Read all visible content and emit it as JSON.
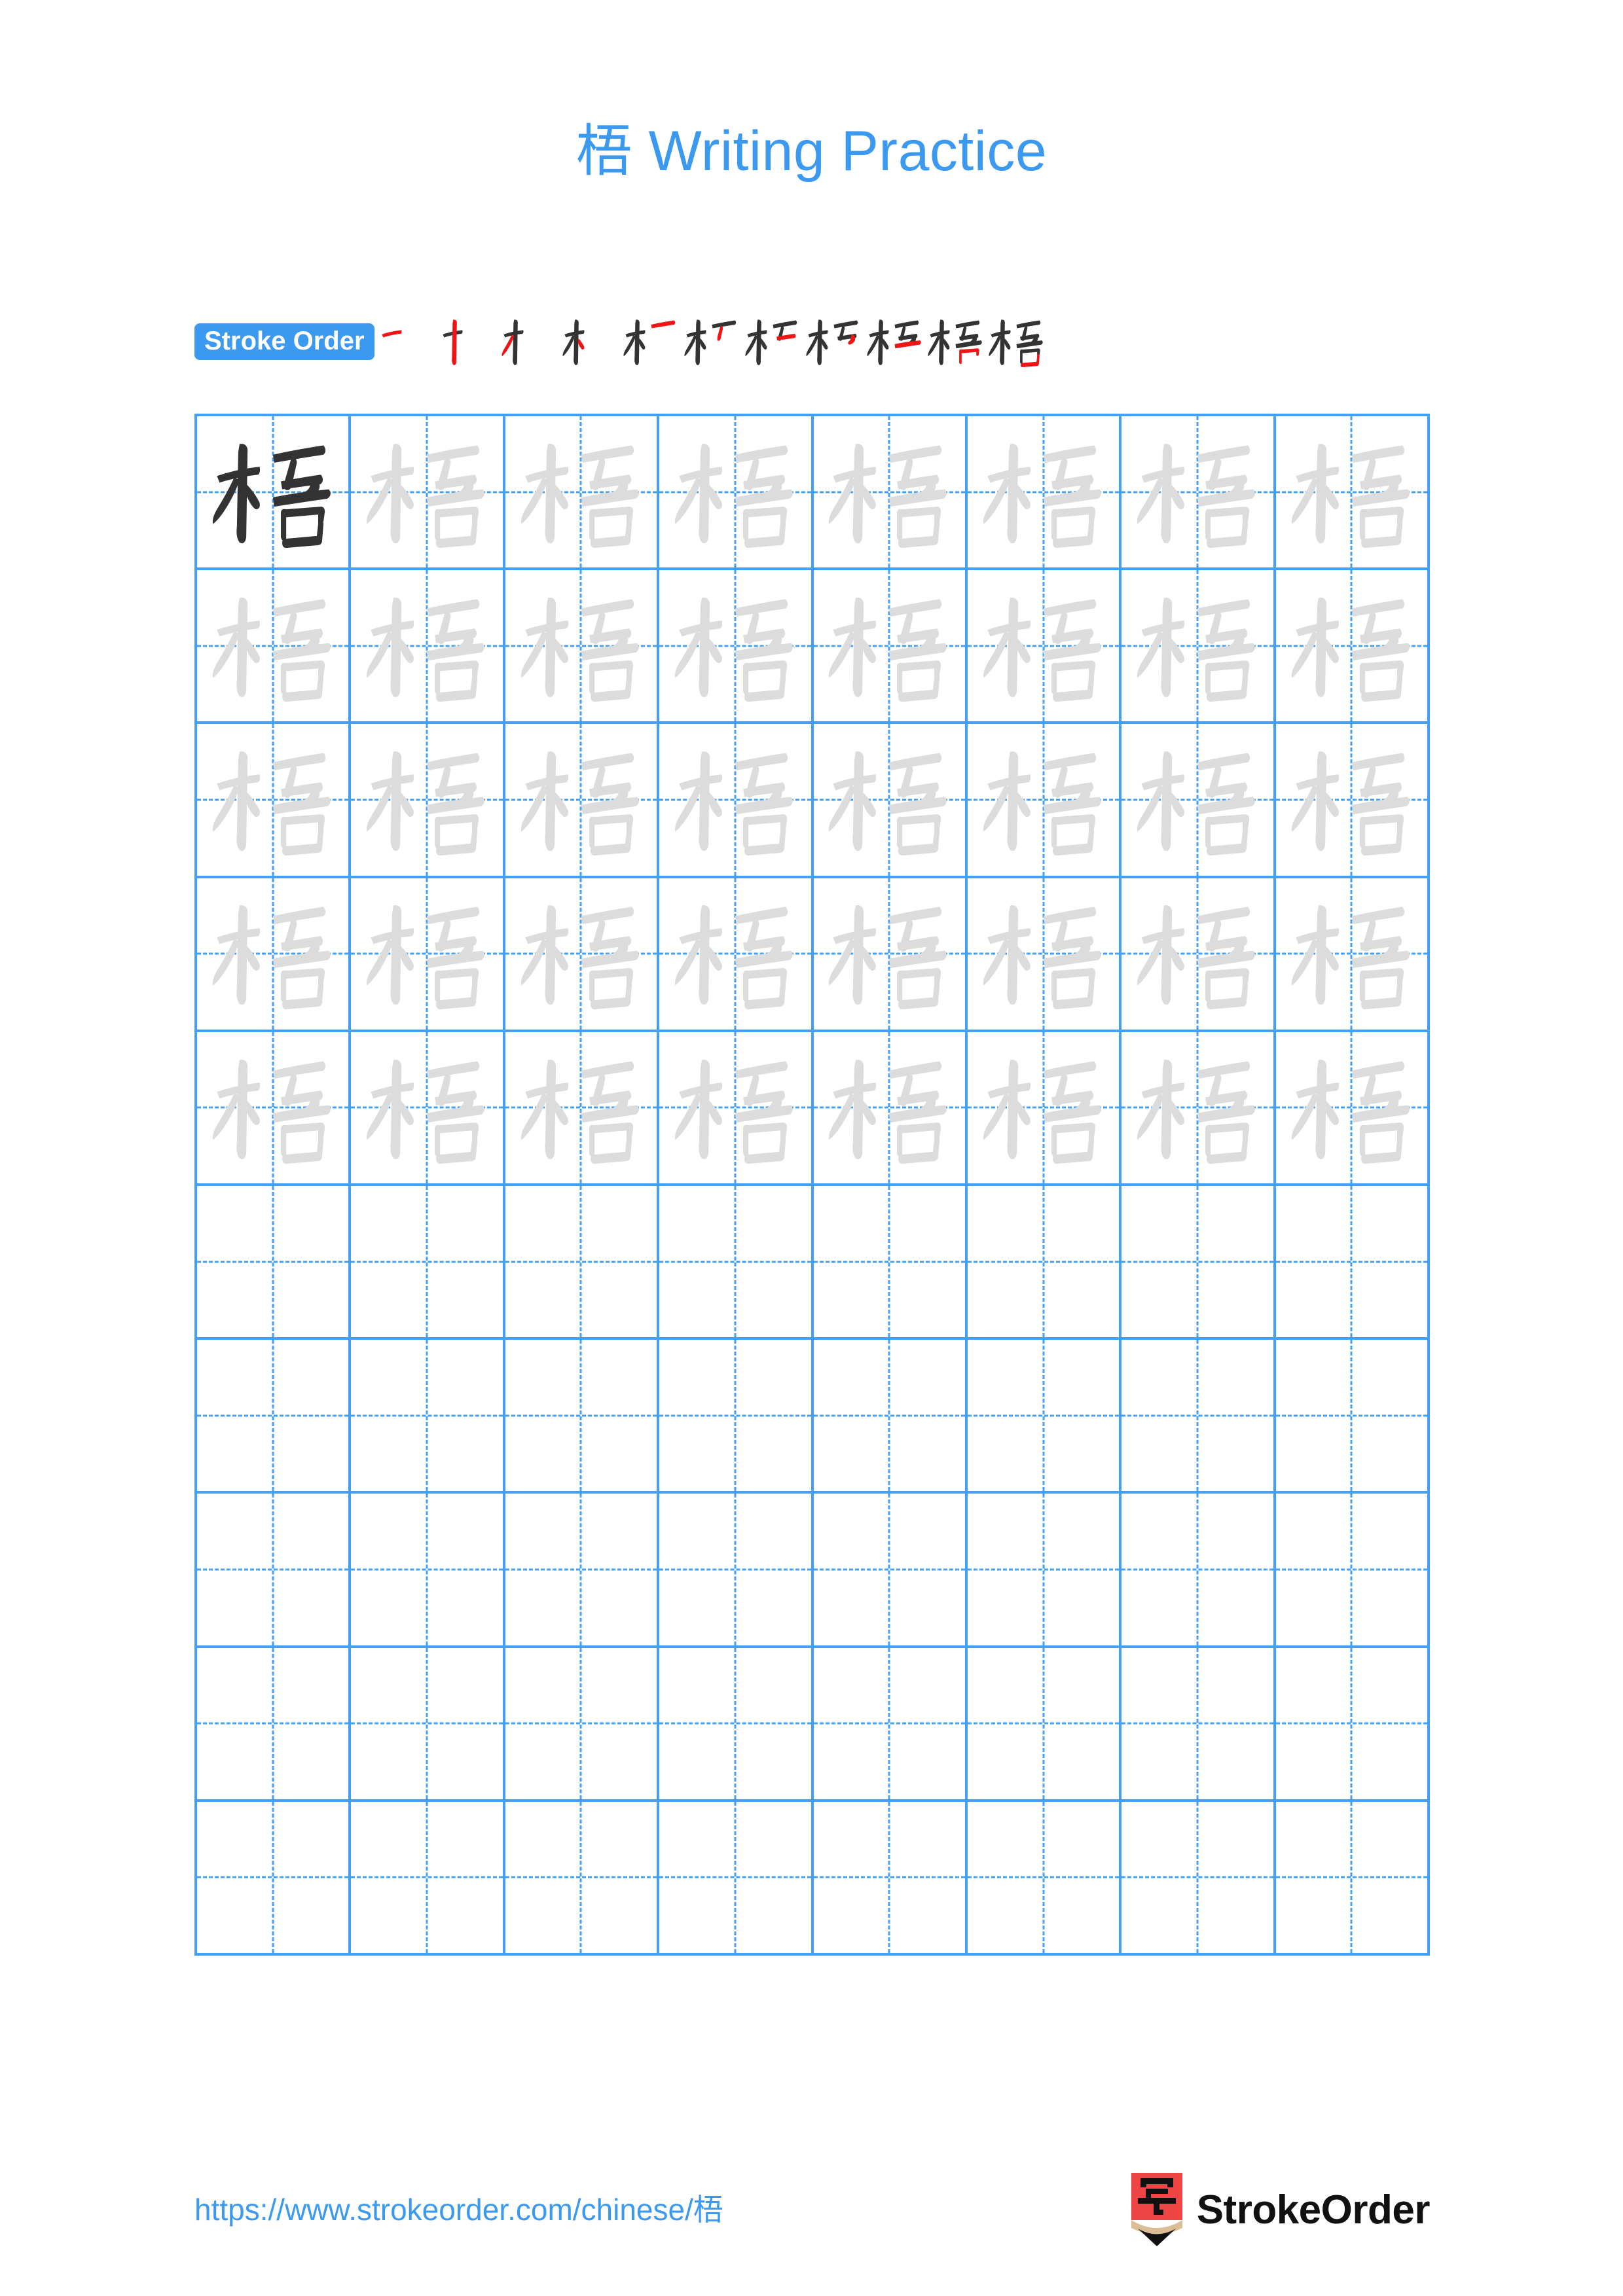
{
  "document": {
    "character": "梧",
    "title": "梧 Writing Practice",
    "title_prefix": "梧",
    "title_suffix": " Writing Practice",
    "page_background": "#ffffff"
  },
  "colors": {
    "accent_blue": "#3B9AF0",
    "grid_blue": "#43A0F5",
    "model_char": "#333333",
    "trace_char": "#DCDCDC",
    "new_stroke_red": "#F01414",
    "existing_stroke": "#333333",
    "logo_red": "#F04545",
    "logo_wood": "#DCBE96",
    "logo_tip": "#111111",
    "brand_text": "#111111"
  },
  "stroke_order": {
    "label": "Stroke Order",
    "total_strokes": 11,
    "steps": [
      {
        "index": 1,
        "glyph": "一"
      },
      {
        "index": 2,
        "glyph": "十"
      },
      {
        "index": 3,
        "glyph": "才"
      },
      {
        "index": 4,
        "glyph": "木"
      },
      {
        "index": 5,
        "glyph": "朩"
      },
      {
        "index": 6,
        "glyph": "杄"
      },
      {
        "index": 7,
        "glyph": "柘"
      },
      {
        "index": 8,
        "glyph": "栢"
      },
      {
        "index": 9,
        "glyph": "梧"
      },
      {
        "index": 10,
        "glyph": "梧"
      },
      {
        "index": 11,
        "glyph": "梧"
      }
    ]
  },
  "grid": {
    "rows": 10,
    "columns": 8,
    "filled_rows": 5,
    "empty_rows": 5,
    "model_cell": {
      "row": 1,
      "column": 1
    },
    "cells": [
      [
        {
          "char": "梧",
          "style": "model"
        },
        {
          "char": "梧",
          "style": "trace"
        },
        {
          "char": "梧",
          "style": "trace"
        },
        {
          "char": "梧",
          "style": "trace"
        },
        {
          "char": "梧",
          "style": "trace"
        },
        {
          "char": "梧",
          "style": "trace"
        },
        {
          "char": "梧",
          "style": "trace"
        },
        {
          "char": "梧",
          "style": "trace"
        }
      ],
      [
        {
          "char": "梧",
          "style": "trace"
        },
        {
          "char": "梧",
          "style": "trace"
        },
        {
          "char": "梧",
          "style": "trace"
        },
        {
          "char": "梧",
          "style": "trace"
        },
        {
          "char": "梧",
          "style": "trace"
        },
        {
          "char": "梧",
          "style": "trace"
        },
        {
          "char": "梧",
          "style": "trace"
        },
        {
          "char": "梧",
          "style": "trace"
        }
      ],
      [
        {
          "char": "梧",
          "style": "trace"
        },
        {
          "char": "梧",
          "style": "trace"
        },
        {
          "char": "梧",
          "style": "trace"
        },
        {
          "char": "梧",
          "style": "trace"
        },
        {
          "char": "梧",
          "style": "trace"
        },
        {
          "char": "梧",
          "style": "trace"
        },
        {
          "char": "梧",
          "style": "trace"
        },
        {
          "char": "梧",
          "style": "trace"
        }
      ],
      [
        {
          "char": "梧",
          "style": "trace"
        },
        {
          "char": "梧",
          "style": "trace"
        },
        {
          "char": "梧",
          "style": "trace"
        },
        {
          "char": "梧",
          "style": "trace"
        },
        {
          "char": "梧",
          "style": "trace"
        },
        {
          "char": "梧",
          "style": "trace"
        },
        {
          "char": "梧",
          "style": "trace"
        },
        {
          "char": "梧",
          "style": "trace"
        }
      ],
      [
        {
          "char": "梧",
          "style": "trace"
        },
        {
          "char": "梧",
          "style": "trace"
        },
        {
          "char": "梧",
          "style": "trace"
        },
        {
          "char": "梧",
          "style": "trace"
        },
        {
          "char": "梧",
          "style": "trace"
        },
        {
          "char": "梧",
          "style": "trace"
        },
        {
          "char": "梧",
          "style": "trace"
        },
        {
          "char": "梧",
          "style": "trace"
        }
      ],
      [
        {
          "char": "",
          "style": "empty"
        },
        {
          "char": "",
          "style": "empty"
        },
        {
          "char": "",
          "style": "empty"
        },
        {
          "char": "",
          "style": "empty"
        },
        {
          "char": "",
          "style": "empty"
        },
        {
          "char": "",
          "style": "empty"
        },
        {
          "char": "",
          "style": "empty"
        },
        {
          "char": "",
          "style": "empty"
        }
      ],
      [
        {
          "char": "",
          "style": "empty"
        },
        {
          "char": "",
          "style": "empty"
        },
        {
          "char": "",
          "style": "empty"
        },
        {
          "char": "",
          "style": "empty"
        },
        {
          "char": "",
          "style": "empty"
        },
        {
          "char": "",
          "style": "empty"
        },
        {
          "char": "",
          "style": "empty"
        },
        {
          "char": "",
          "style": "empty"
        }
      ],
      [
        {
          "char": "",
          "style": "empty"
        },
        {
          "char": "",
          "style": "empty"
        },
        {
          "char": "",
          "style": "empty"
        },
        {
          "char": "",
          "style": "empty"
        },
        {
          "char": "",
          "style": "empty"
        },
        {
          "char": "",
          "style": "empty"
        },
        {
          "char": "",
          "style": "empty"
        },
        {
          "char": "",
          "style": "empty"
        }
      ],
      [
        {
          "char": "",
          "style": "empty"
        },
        {
          "char": "",
          "style": "empty"
        },
        {
          "char": "",
          "style": "empty"
        },
        {
          "char": "",
          "style": "empty"
        },
        {
          "char": "",
          "style": "empty"
        },
        {
          "char": "",
          "style": "empty"
        },
        {
          "char": "",
          "style": "empty"
        },
        {
          "char": "",
          "style": "empty"
        }
      ],
      [
        {
          "char": "",
          "style": "empty"
        },
        {
          "char": "",
          "style": "empty"
        },
        {
          "char": "",
          "style": "empty"
        },
        {
          "char": "",
          "style": "empty"
        },
        {
          "char": "",
          "style": "empty"
        },
        {
          "char": "",
          "style": "empty"
        },
        {
          "char": "",
          "style": "empty"
        },
        {
          "char": "",
          "style": "empty"
        }
      ]
    ]
  },
  "footer": {
    "url": "https://www.strokeorder.com/chinese/梧",
    "brand_name": "StrokeOrder",
    "logo_character": "字"
  }
}
